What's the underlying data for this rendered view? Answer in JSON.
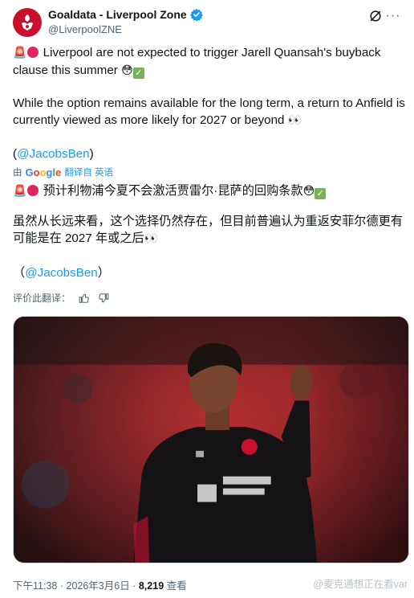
{
  "account": {
    "display_name": "Goaldata - Liverpool Zone",
    "handle": "@LiverpoolZNE"
  },
  "icons": {
    "avatar": "liverpool-crest-icon",
    "verified": "verified-badge-icon",
    "grok": "grok-icon",
    "more": "more-options-icon",
    "thumbs_up": "thumbs-up-icon",
    "thumbs_down": "thumbs-down-icon"
  },
  "tweet": {
    "line1": "Liverpool are not expected to trigger Jarell Quansah's buyback clause this summer",
    "line2": "While the option remains available for the long term, a return to Anfield is currently viewed as more likely for 2027 or beyond",
    "source_open": "(",
    "source_link": "@JacobsBen",
    "source_close": ")"
  },
  "translation": {
    "by_label": "由",
    "google": "Google",
    "translated_from": "翻译自 英语",
    "line1": "预计利物浦今夏不会激活贾雷尔·昆萨的回购条款",
    "line2": "虽然从长远来看，这个选择仍然存在，但目前普遍认为重返安菲尔德更有可能是在 2027 年或之后",
    "source_open": "（",
    "source_link": "@JacobsBen",
    "source_close": "）",
    "rate_label": "评价此翻译："
  },
  "footer": {
    "time": "下午11:38",
    "sep1": "·",
    "date": "2026年3月6日",
    "sep2": "·",
    "views": "8,219",
    "views_label": "查看"
  },
  "watermark": "@麦克通想正在看var",
  "colors": {
    "accent": "#1d9bf0",
    "text": "#0f1419",
    "muted": "#536471",
    "verified": "#1d9bf0",
    "liverpool_red": "#c8102e"
  }
}
